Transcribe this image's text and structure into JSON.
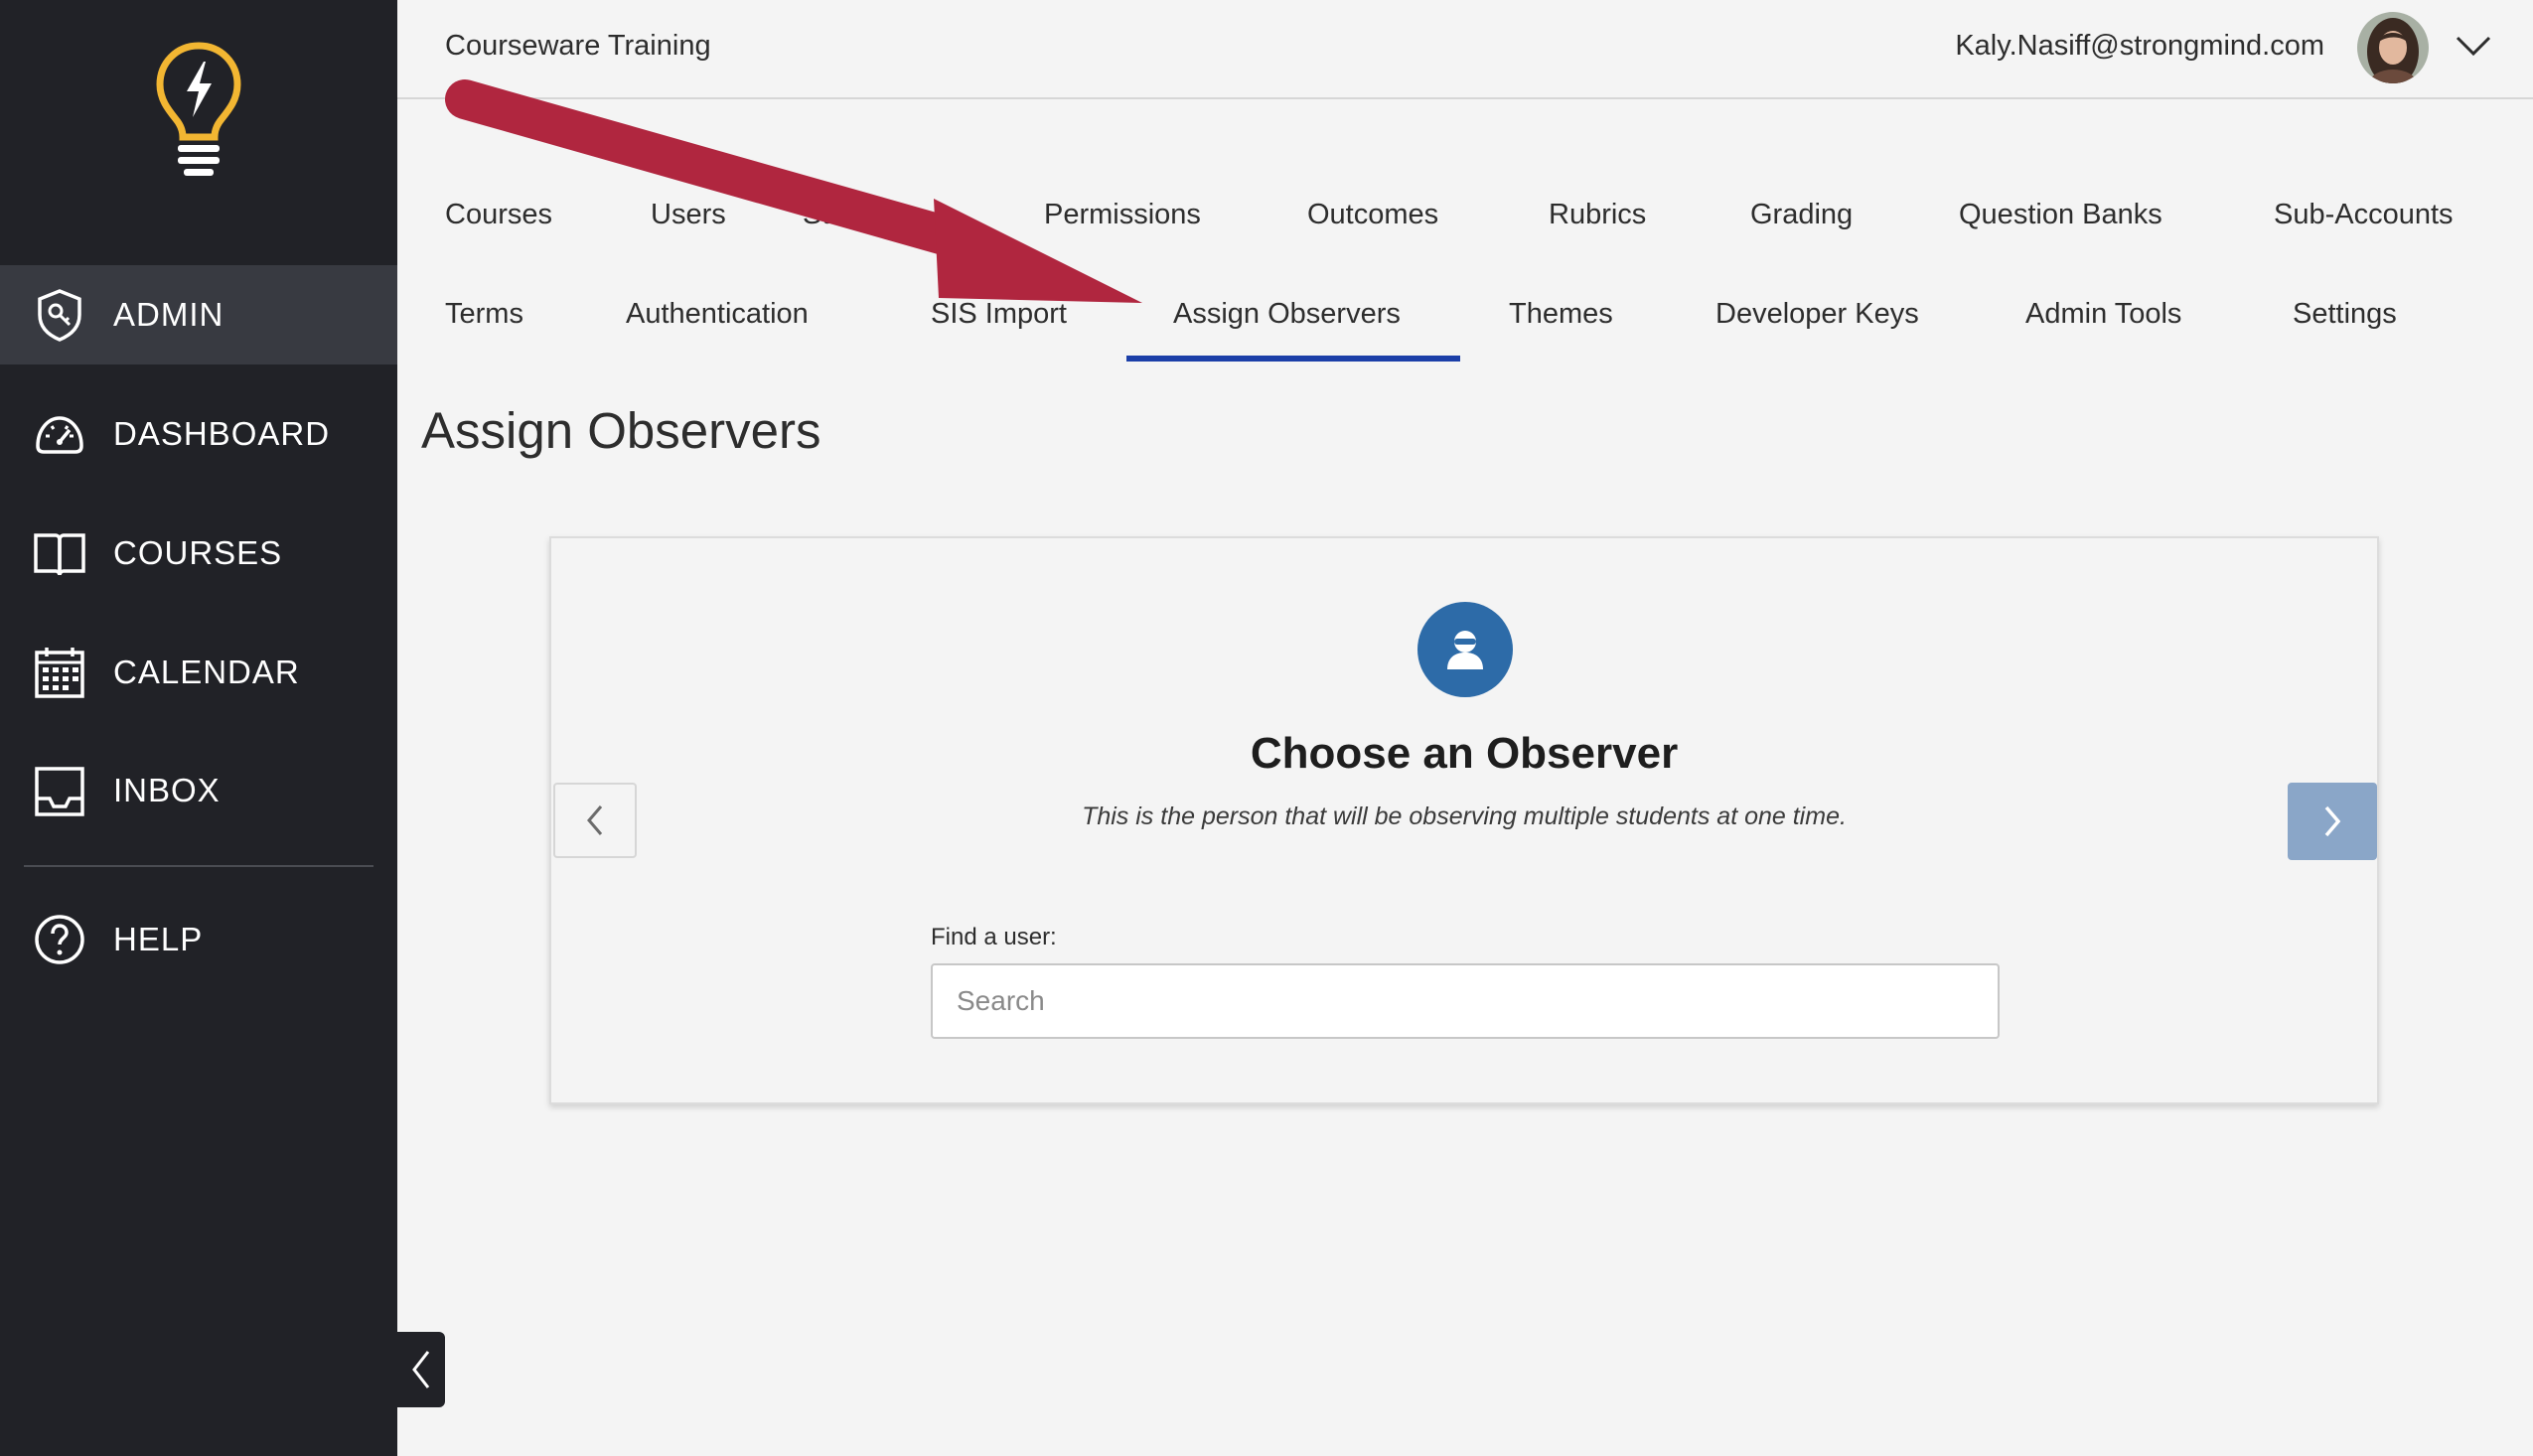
{
  "sidebar": {
    "logo_icon": "lightbulb-bolt-icon",
    "items": [
      {
        "label": "ADMIN",
        "icon": "shield-key-icon",
        "active": true
      },
      {
        "label": "DASHBOARD",
        "icon": "speedometer-icon",
        "active": false
      },
      {
        "label": "COURSES",
        "icon": "book-icon",
        "active": false
      },
      {
        "label": "CALENDAR",
        "icon": "calendar-icon",
        "active": false
      },
      {
        "label": "INBOX",
        "icon": "inbox-tray-icon",
        "active": false
      },
      {
        "label": "HELP",
        "icon": "question-circle-icon",
        "active": false
      }
    ],
    "collapse_icon": "chevron-left-icon"
  },
  "topbar": {
    "account_title": "Courseware Training",
    "user_email": "Kaly.Nasiff@strongmind.com",
    "menu_icon": "chevron-down-icon"
  },
  "tabs": {
    "row1": [
      "Courses",
      "Users",
      "Statistics",
      "Permissions",
      "Outcomes",
      "Rubrics",
      "Grading",
      "Question Banks",
      "Sub-Accounts"
    ],
    "row2": [
      "Terms",
      "Authentication",
      "SIS Import",
      "Assign Observers",
      "Themes",
      "Developer Keys",
      "Admin Tools",
      "Settings"
    ],
    "active": "Assign Observers"
  },
  "page": {
    "title": "Assign Observers"
  },
  "card": {
    "icon": "user-observer-icon",
    "title": "Choose an Observer",
    "subtitle": "This is the person that will be observing multiple students at one time.",
    "find_label": "Find a user:",
    "search_placeholder": "Search",
    "search_value": ""
  },
  "colors": {
    "sidebar_bg": "#212227",
    "sidebar_active": "#383a41",
    "accent_yellow": "#f2b632",
    "tab_underline": "#1b3fa8",
    "icon_blue": "#2d6ba8",
    "next_button": "#8aa6c8",
    "annotation_arrow": "#b0263f"
  }
}
